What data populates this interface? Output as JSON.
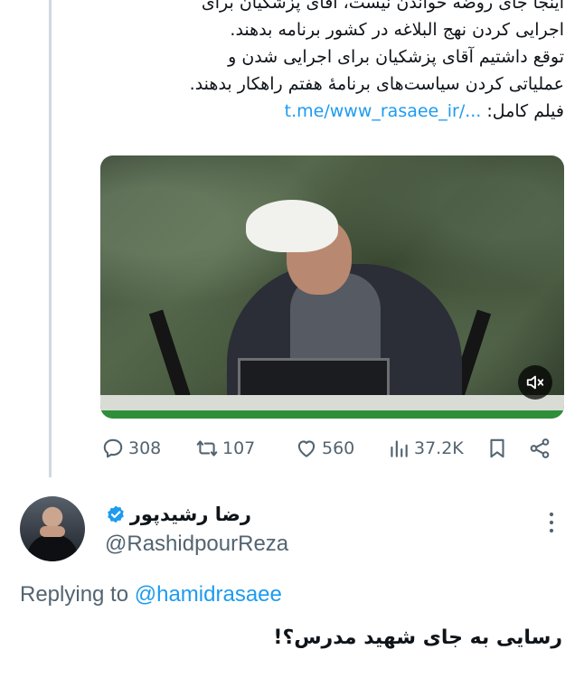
{
  "tweet": {
    "lines": [
      "اینجا جای روضه خواندن نیست، آقای پزشکیان برای",
      "اجرایی کردن نهج البلاغه در کشور برنامه بدهند.",
      "توقع داشتیم آقای پزشکیان برای اجرایی شدن و",
      "عملیاتی کردن سیاست‌های برنامهٔ هفتم راهکار بدهند."
    ],
    "film_label": "فیلم کامل:",
    "link_text": "t.me/www_rasaee_ir/..."
  },
  "media": {
    "mute_icon": "speaker-muted-icon"
  },
  "actions": {
    "replies": "308",
    "retweets": "107",
    "likes": "560",
    "views": "37.2K"
  },
  "reply": {
    "display_name": "رضا رشیدپور",
    "handle": "@RashidpourReza",
    "replying_prefix": "Replying to",
    "replying_to": "@hamidrasaee",
    "text": "رسایی به جای شهید مدرس؟!"
  },
  "colors": {
    "link": "#1d9bf0",
    "secondary_text": "#536471",
    "primary_text": "#0f1419",
    "thread_line": "#cfd9de"
  }
}
